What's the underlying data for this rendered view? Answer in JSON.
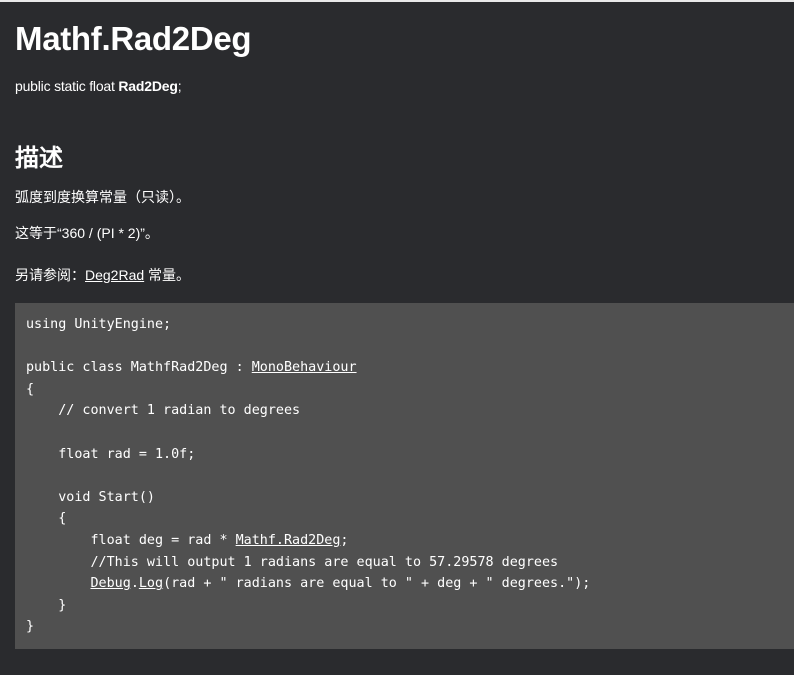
{
  "page": {
    "title": "Mathf.Rad2Deg",
    "signature": {
      "prefix": "public static float ",
      "member": "Rad2Deg",
      "suffix": ";"
    },
    "description_heading": "描述",
    "description_line1": "弧度到度换算常量（只读）。",
    "description_line2": "这等于“360 / (PI * 2)”。",
    "see_also": {
      "prefix": "另请参阅：",
      "link": "Deg2Rad",
      "suffix": " 常量。"
    }
  },
  "code": {
    "line1": "using UnityEngine;",
    "line2": "",
    "line3_prefix": "public class MathfRad2Deg : ",
    "line3_link": "MonoBehaviour",
    "line4": "{",
    "line5": "    // convert 1 radian to degrees",
    "line6": "",
    "line7": "    float rad = 1.0f;",
    "line8": "",
    "line9": "    void Start()",
    "line10": "    {",
    "line11_prefix": "        float deg = rad * ",
    "line11_link": "Mathf.Rad2Deg",
    "line11_suffix": ";",
    "line12": "        //This will output 1 radians are equal to 57.29578 degrees",
    "line13_indent": "        ",
    "line13_link1": "Debug",
    "line13_dot": ".",
    "line13_link2": "Log",
    "line13_suffix": "(rad + \" radians are equal to \" + deg + \" degrees.\");",
    "line14": "    }",
    "line15": "}"
  }
}
